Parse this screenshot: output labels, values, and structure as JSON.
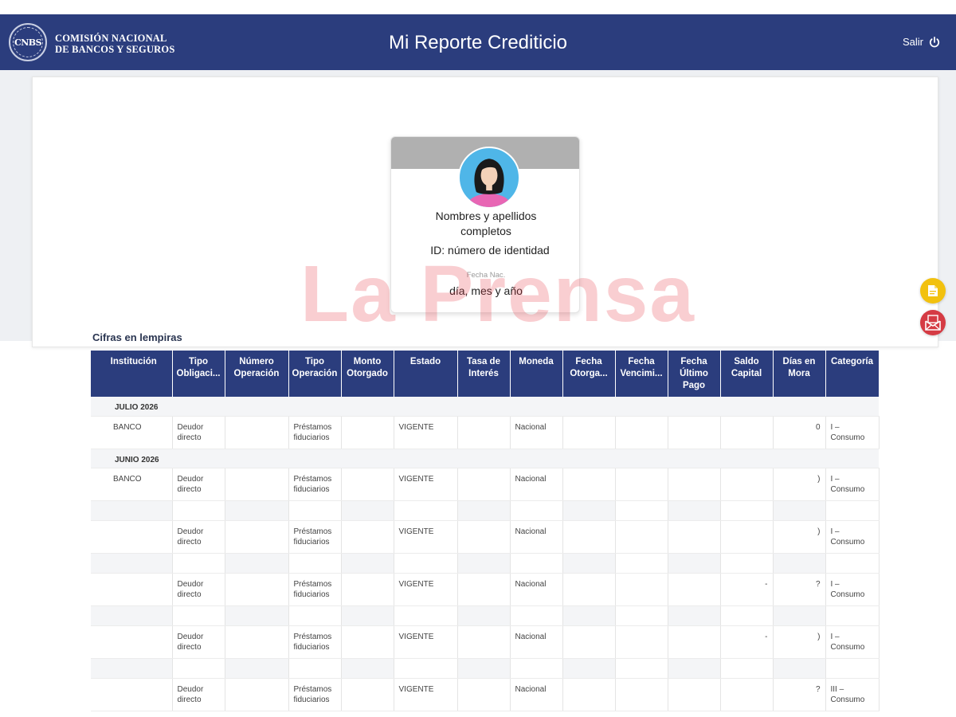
{
  "header": {
    "org_line1": "COMISIÓN NACIONAL",
    "org_line2": "DE BANCOS Y SEGUROS",
    "logo_text": "CNBS",
    "title": "Mi Reporte Crediticio",
    "logout_label": "Salir"
  },
  "profile": {
    "name": "Nombres y apellidos completos",
    "id_line": "ID: número de identidad",
    "dob_label": "Fecha Nac.",
    "dob_value": "día, mes y año"
  },
  "watermark": "La Prensa",
  "actions": {
    "pdf_icon": "pdf-file-icon",
    "mail_icon": "email-icon"
  },
  "section_title": "Cifras en lempiras",
  "table": {
    "headers": [
      "Institución",
      "Tipo Obligaci...",
      "Número Operación",
      "Tipo Operación",
      "Monto Otorgado",
      "Estado",
      "Tasa de Interés",
      "Moneda",
      "Fecha Otorga...",
      "Fecha Vencimi...",
      "Fecha Último Pago",
      "Saldo Capital",
      "Días en Mora",
      "Categoría"
    ],
    "groups": [
      {
        "month": "JULIO 2026",
        "rows": [
          {
            "institucion": "BANCO",
            "tipo_obligacion": "Deudor directo",
            "numero": "",
            "tipo_operacion": "Préstamos fiduciarios",
            "monto": "",
            "estado": "VIGENTE",
            "tasa": "",
            "moneda": "Nacional",
            "f_otorga": "",
            "f_venc": "",
            "f_ultimo": "",
            "saldo": "",
            "mora": "0",
            "categoria": "I – Consumo"
          }
        ]
      },
      {
        "month": "JUNIO 2026",
        "rows": [
          {
            "institucion": "BANCO",
            "tipo_obligacion": "Deudor directo",
            "numero": "",
            "tipo_operacion": "Préstamos fiduciarios",
            "monto": "",
            "estado": "VIGENTE",
            "tasa": "",
            "moneda": "Nacional",
            "f_otorga": "",
            "f_venc": "",
            "f_ultimo": "",
            "saldo": "",
            "mora": ")",
            "categoria": "I – Consumo"
          },
          {
            "institucion": "",
            "tipo_obligacion": "Deudor directo",
            "numero": "",
            "tipo_operacion": "Préstamos fiduciarios",
            "monto": "",
            "estado": "VIGENTE",
            "tasa": "",
            "moneda": "Nacional",
            "f_otorga": "",
            "f_venc": "",
            "f_ultimo": "",
            "saldo": "",
            "mora": ")",
            "categoria": "I – Consumo"
          },
          {
            "institucion": "",
            "tipo_obligacion": "Deudor directo",
            "numero": "",
            "tipo_operacion": "Préstamos fiduciarios",
            "monto": "",
            "estado": "VIGENTE",
            "tasa": "",
            "moneda": "Nacional",
            "f_otorga": "",
            "f_venc": "",
            "f_ultimo": "",
            "saldo": "-",
            "mora": "?",
            "categoria": "I – Consumo"
          },
          {
            "institucion": "",
            "tipo_obligacion": "Deudor directo",
            "numero": "",
            "tipo_operacion": "Préstamos fiduciarios",
            "monto": "",
            "estado": "VIGENTE",
            "tasa": "",
            "moneda": "Nacional",
            "f_otorga": "",
            "f_venc": "",
            "f_ultimo": "",
            "saldo": "-",
            "mora": ")",
            "categoria": "I – Consumo"
          },
          {
            "institucion": "",
            "tipo_obligacion": "Deudor directo",
            "numero": "",
            "tipo_operacion": "Préstamos fiduciarios",
            "monto": "",
            "estado": "VIGENTE",
            "tasa": "",
            "moneda": "Nacional",
            "f_otorga": "",
            "f_venc": "",
            "f_ultimo": "",
            "saldo": "",
            "mora": "?",
            "categoria": "III – Consumo"
          }
        ]
      }
    ]
  },
  "colors": {
    "header_bg": "#2b3d7d",
    "pdf_button": "#f2c10f",
    "mail_button": "#d53b44",
    "watermark": "#e63c46"
  }
}
